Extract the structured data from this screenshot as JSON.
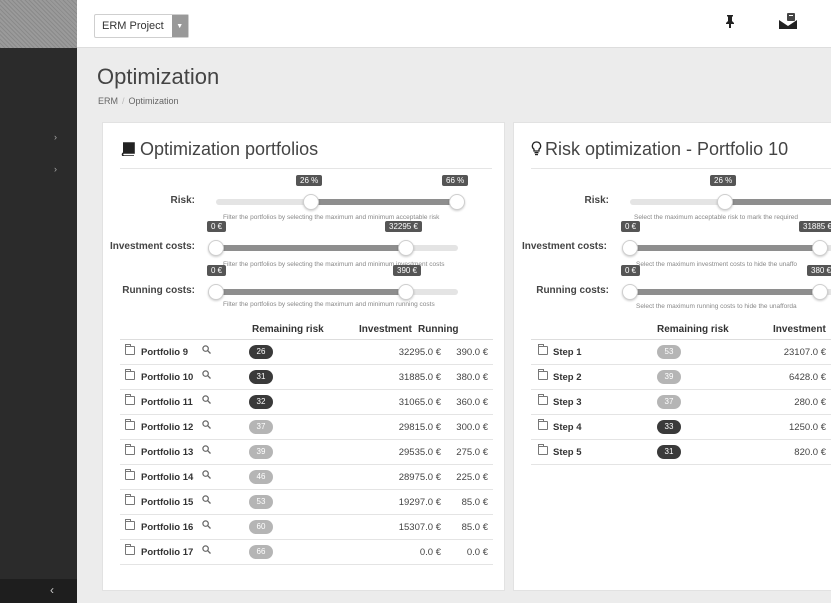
{
  "topbar": {
    "project": "ERM Project"
  },
  "page": {
    "title": "Optimization",
    "breadcrumb": [
      "ERM",
      "Optimization"
    ]
  },
  "colors": {
    "badge_dark": "#3a3a3a",
    "badge_light": "#b5b5b5",
    "sidebar": "#2b2b2b",
    "slider_fill": "#8e8e8e"
  },
  "left": {
    "title": "Optimization portfolios",
    "sliders": {
      "risk": {
        "label": "Risk:",
        "min": "26 %",
        "max": "66 %",
        "hint": "Filter the portfolios by selecting the maximum and minimum acceptable risk"
      },
      "investment": {
        "label": "Investment costs:",
        "min": "0 €",
        "max": "32295 €",
        "hint": "Filter the portfolios by selecting the maximum and minimum investment costs"
      },
      "running": {
        "label": "Running costs:",
        "min": "0 €",
        "max": "390 €",
        "hint": "Filter the portfolios by selecting the maximum and minimum running costs"
      }
    },
    "headers": {
      "risk": "Remaining risk",
      "investment": "Investment",
      "running": "Running"
    },
    "rows": [
      {
        "name": "Portfolio 9",
        "risk": "26",
        "tone": "dark",
        "investment": "32295.0 €",
        "running": "390.0 €"
      },
      {
        "name": "Portfolio 10",
        "risk": "31",
        "tone": "dark",
        "investment": "31885.0 €",
        "running": "380.0 €"
      },
      {
        "name": "Portfolio 11",
        "risk": "32",
        "tone": "dark",
        "investment": "31065.0 €",
        "running": "360.0 €"
      },
      {
        "name": "Portfolio 12",
        "risk": "37",
        "tone": "light",
        "investment": "29815.0 €",
        "running": "300.0 €"
      },
      {
        "name": "Portfolio 13",
        "risk": "39",
        "tone": "light",
        "investment": "29535.0 €",
        "running": "275.0 €"
      },
      {
        "name": "Portfolio 14",
        "risk": "46",
        "tone": "light",
        "investment": "28975.0 €",
        "running": "225.0 €"
      },
      {
        "name": "Portfolio 15",
        "risk": "53",
        "tone": "light",
        "investment": "19297.0 €",
        "running": "85.0 €"
      },
      {
        "name": "Portfolio 16",
        "risk": "60",
        "tone": "light",
        "investment": "15307.0 €",
        "running": "85.0 €"
      },
      {
        "name": "Portfolio 17",
        "risk": "66",
        "tone": "light",
        "investment": "0.0 €",
        "running": "0.0 €"
      }
    ]
  },
  "right": {
    "title": "Risk optimization - Portfolio 10",
    "sliders": {
      "risk": {
        "label": "Risk:",
        "value": "26 %",
        "hint": "Select the maximum acceptable risk to mark the required"
      },
      "investment": {
        "label": "Investment costs:",
        "min": "0 €",
        "max": "31885 €",
        "hint": "Select the maximum investment costs to hide the unaffo"
      },
      "running": {
        "label": "Running costs:",
        "min": "0 €",
        "max": "380 €",
        "hint": "Select the maximum running costs to hide the unafforda"
      }
    },
    "headers": {
      "risk": "Remaining risk",
      "investment": "Investment"
    },
    "rows": [
      {
        "name": "Step 1",
        "risk": "53",
        "tone": "light",
        "investment": "23107.0 €"
      },
      {
        "name": "Step 2",
        "risk": "39",
        "tone": "light",
        "investment": "6428.0 €"
      },
      {
        "name": "Step 3",
        "risk": "37",
        "tone": "light",
        "investment": "280.0 €"
      },
      {
        "name": "Step 4",
        "risk": "33",
        "tone": "dark",
        "investment": "1250.0 €"
      },
      {
        "name": "Step 5",
        "risk": "31",
        "tone": "dark",
        "investment": "820.0 €"
      }
    ]
  }
}
